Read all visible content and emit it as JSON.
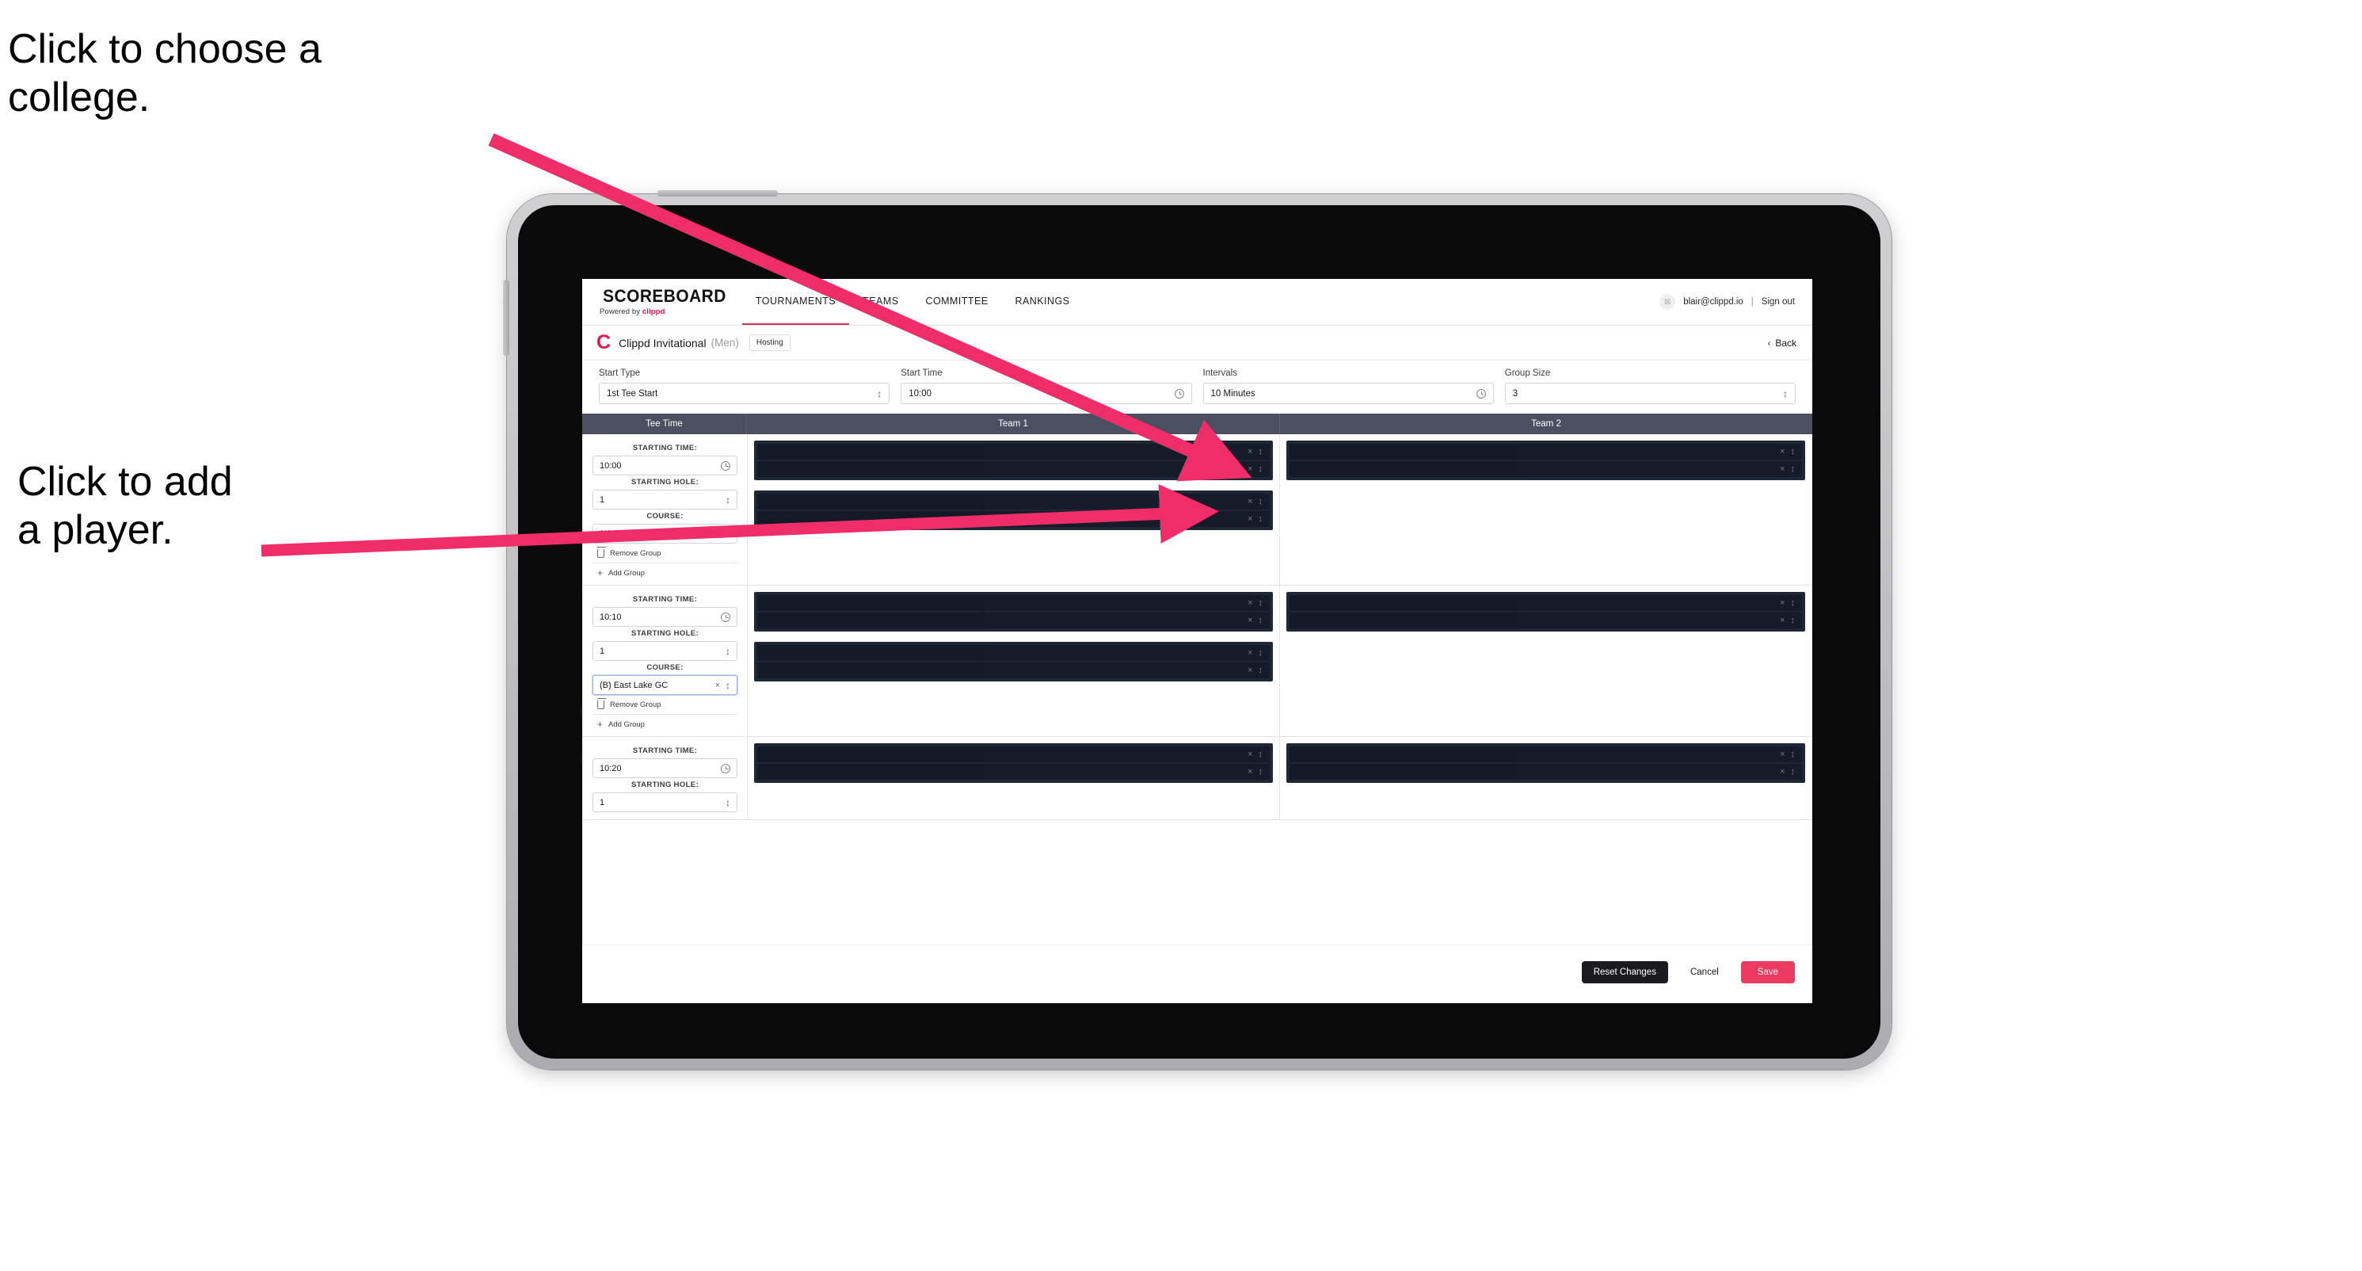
{
  "annotations": [
    {
      "id": "choose-college",
      "text": "Click to choose a\ncollege."
    },
    {
      "id": "add-player",
      "text": "Click to add\na player."
    }
  ],
  "colors": {
    "accent_pink": "#eb3a60",
    "brand_red": "#e21d4e",
    "arrow_pink": "#ef2d68",
    "table_header": "#4a4f61",
    "player_row_dark": "#151b28"
  },
  "navbar": {
    "brand_title": "SCOREBOARD",
    "brand_sub_prefix": "Powered by ",
    "brand_sub_brand": "clippd",
    "tabs": [
      {
        "label": "TOURNAMENTS",
        "active": true
      },
      {
        "label": "TEAMS",
        "active": false
      },
      {
        "label": "COMMITTEE",
        "active": false
      },
      {
        "label": "RANKINGS",
        "active": false
      }
    ],
    "avatar_glyph": "☒",
    "email": "blair@clippd.io",
    "separator": "|",
    "sign_out": "Sign out"
  },
  "titlebar": {
    "logo_letter": "C",
    "tournament_name": "Clippd Invitational",
    "gender": "(Men)",
    "hosting_chip": "Hosting",
    "back_label": "Back",
    "back_chevron": "‹"
  },
  "controls": [
    {
      "label": "Start Type",
      "value": "1st Tee Start",
      "icon": "updown-icon",
      "name": "start-type"
    },
    {
      "label": "Start Time",
      "value": "10:00",
      "icon": "clock-icon",
      "name": "start-time"
    },
    {
      "label": "Intervals",
      "value": "10 Minutes",
      "icon": "clock-icon",
      "name": "intervals"
    },
    {
      "label": "Group Size",
      "value": "3",
      "icon": "updown-icon",
      "name": "group-size"
    }
  ],
  "table": {
    "headers": {
      "tee_time": "Tee Time",
      "team1": "Team 1",
      "team2": "Team 2"
    },
    "field_labels": {
      "starting_time": "STARTING TIME:",
      "starting_hole": "STARTING HOLE:",
      "course": "COURSE:"
    },
    "group_actions": {
      "remove": "Remove Group",
      "add": "Add Group"
    },
    "icons": {
      "clear": "×",
      "updown": "⇅",
      "plus": "+"
    },
    "rows": [
      {
        "starting_time": "10:00",
        "starting_hole": "1",
        "course": "(A) Peachtree GC",
        "course_focused": false,
        "team1_groups": [
          {
            "players": [
              "",
              ""
            ]
          },
          {
            "players": [
              "",
              ""
            ]
          }
        ],
        "team2_groups": [
          {
            "players": [
              "",
              ""
            ]
          }
        ]
      },
      {
        "starting_time": "10:10",
        "starting_hole": "1",
        "course": "(B) East Lake GC",
        "course_focused": true,
        "team1_groups": [
          {
            "players": [
              "",
              ""
            ]
          },
          {
            "players": [
              "",
              ""
            ]
          }
        ],
        "team2_groups": [
          {
            "players": [
              "",
              ""
            ]
          }
        ]
      },
      {
        "starting_time": "10:20",
        "starting_hole": "1",
        "course": "",
        "course_focused": false,
        "team1_groups": [
          {
            "players": [
              "",
              ""
            ]
          }
        ],
        "team2_groups": [
          {
            "players": [
              "",
              ""
            ]
          }
        ]
      }
    ]
  },
  "footer": {
    "reset": "Reset Changes",
    "cancel": "Cancel",
    "save": "Save"
  }
}
